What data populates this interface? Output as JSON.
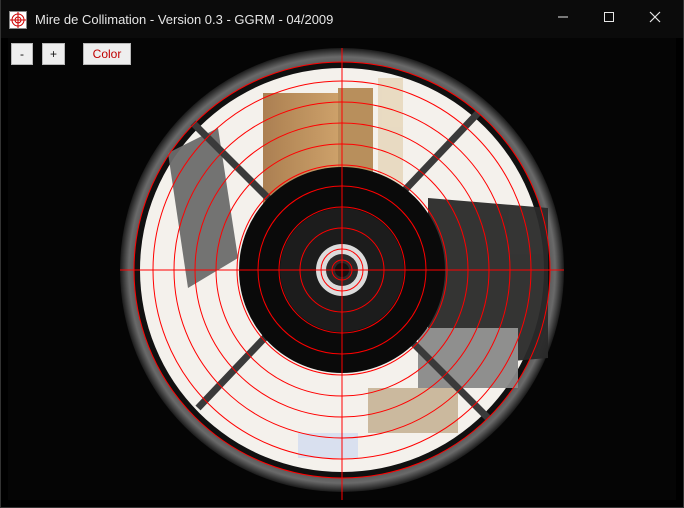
{
  "window": {
    "title": "Mire de Collimation - Version 0.3 - GGRM - 04/2009",
    "icon": "collimation-target-icon",
    "controls": {
      "minimize": "minimize-icon",
      "maximize": "maximize-icon",
      "close": "close-icon"
    }
  },
  "toolbar": {
    "zoom_out_label": "-",
    "zoom_in_label": "+",
    "color_label": "Color"
  },
  "colors": {
    "reticle": "#ff0000",
    "color_button_text": "#c00000",
    "titlebar": "#0b0b0b"
  }
}
